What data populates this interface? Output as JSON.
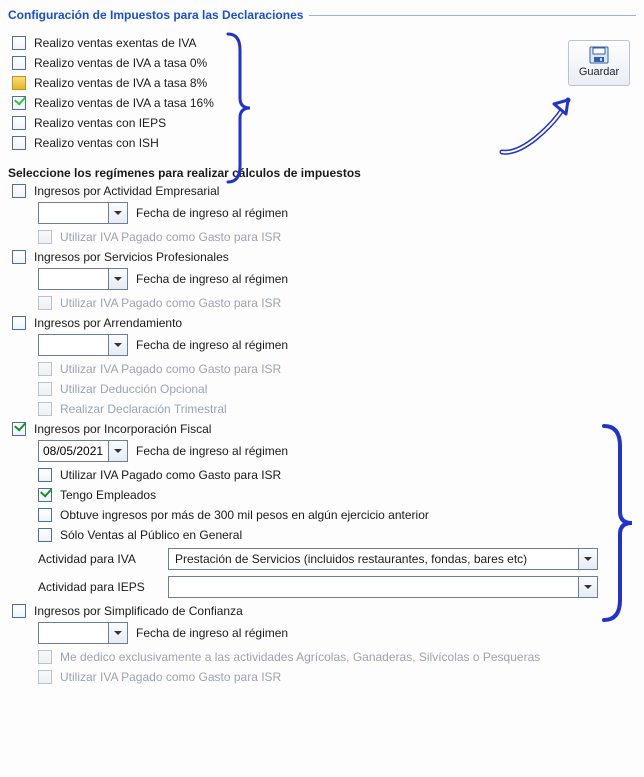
{
  "section_title": "Configuración de Impuestos para las Declaraciones",
  "save_label": "Guardar",
  "tax_checks": {
    "exentas": "Realizo ventas exentas de IVA",
    "tasa0": "Realizo ventas de IVA a tasa 0%",
    "tasa8": "Realizo ventas de IVA a tasa 8%",
    "tasa16": "Realizo ventas de IVA a tasa 16%",
    "ieps": "Realizo ventas con IEPS",
    "ish": "Realizo ventas con ISH"
  },
  "regimes_header": "Seleccione los regímenes para realizar cálculos de impuestos",
  "common": {
    "fecha_ingreso": "Fecha de ingreso al régimen",
    "iva_pagado_gasto": "Utilizar IVA Pagado como Gasto para ISR",
    "deduccion_opcional": "Utilizar Deducción Opcional",
    "decl_trimestral": "Realizar Declaración Trimestral"
  },
  "r1": {
    "title": "Ingresos por Actividad Empresarial",
    "date": ""
  },
  "r2": {
    "title": "Ingresos por Servicios Profesionales",
    "date": ""
  },
  "r3": {
    "title": "Ingresos por Arrendamiento",
    "date": ""
  },
  "r4": {
    "title": "Ingresos por Incorporación Fiscal",
    "date": "08/05/2021",
    "iva_pagado_gasto": "Utilizar IVA Pagado como Gasto para ISR",
    "tengo_empleados": "Tengo Empleados",
    "ingresos_300k": "Obtuve ingresos por más de 300 mil pesos en algún ejercicio anterior",
    "ventas_publico": "Sólo Ventas al Público en General",
    "actividad_iva_label": "Actividad para IVA",
    "actividad_iva_value": "Prestación de Servicios (incluidos restaurantes, fondas, bares etc)",
    "actividad_ieps_label": "Actividad para IEPS",
    "actividad_ieps_value": ""
  },
  "r5": {
    "title": "Ingresos por Simplificado de Confianza",
    "date": "",
    "me_dedico": "Me dedico exclusivamente a las actividades Agrícolas, Ganaderas, Silvícolas o Pesqueras",
    "iva_pagado_gasto": "Utilizar IVA Pagado como Gasto para ISR"
  }
}
